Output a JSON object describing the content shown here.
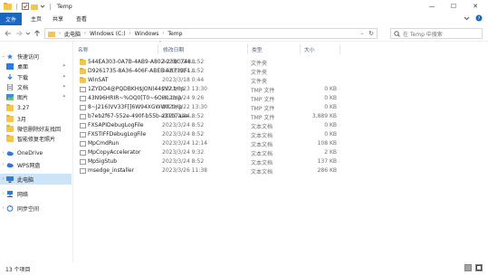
{
  "window": {
    "title": "Temp",
    "controls": {
      "minimize": "—",
      "maximize": "☐",
      "close": "✕"
    }
  },
  "ribbon": {
    "tabs": [
      "文件",
      "主页",
      "共享",
      "查看"
    ]
  },
  "address": {
    "crumbs": [
      "此电脑",
      "Windows (C:)",
      "Windows",
      "Temp"
    ],
    "search_placeholder": "在 Temp 中搜索"
  },
  "sidebar": {
    "items": [
      {
        "label": "快速访问",
        "icon": "star-icon",
        "expand": "⌄"
      },
      {
        "label": "桌面",
        "icon": "desktop-icon",
        "pinned": true
      },
      {
        "label": "下载",
        "icon": "download-icon",
        "pinned": true
      },
      {
        "label": "文档",
        "icon": "document-icon",
        "pinned": true
      },
      {
        "label": "图片",
        "icon": "picture-icon",
        "pinned": true
      },
      {
        "label": "3.27",
        "icon": "folder-icon"
      },
      {
        "label": "3月",
        "icon": "folder-icon"
      },
      {
        "label": "微信删除好友找回",
        "icon": "folder-icon"
      },
      {
        "label": "智能修复老照片",
        "icon": "folder-icon"
      },
      {
        "label": "OneDrive",
        "icon": "cloud-icon",
        "expand": "›"
      },
      {
        "label": "WPS网盘",
        "icon": "wps-cloud-icon",
        "expand": "›"
      },
      {
        "label": "此电脑",
        "icon": "computer-icon",
        "expand": "›",
        "selected": true
      },
      {
        "label": "网络",
        "icon": "network-icon",
        "expand": "›"
      },
      {
        "label": "同步空间",
        "icon": "sync-icon",
        "expand": "›"
      }
    ]
  },
  "columns": {
    "name": "名称",
    "date": "修改日期",
    "type": "类型",
    "size": "大小"
  },
  "files": [
    {
      "name": "544EA303-0A7B-4AB9-A802-23BC748...",
      "date": "2023/3/24 8:52",
      "type": "文件夹",
      "size": "",
      "kind": "folder"
    },
    {
      "name": "D9261735-8A36-406F-ABEB-AB719F1...",
      "date": "2023/3/24 8:52",
      "type": "文件夹",
      "size": "",
      "kind": "folder"
    },
    {
      "name": "WinSAT",
      "date": "2023/3/18 0:44",
      "type": "文件夹",
      "size": "",
      "kind": "folder"
    },
    {
      "name": "1ZYDO4@PQDBKH$JON)44$V2.tmp",
      "date": "2023/3/23 13:30",
      "type": "TMP 文件",
      "size": "0 KB",
      "kind": "file"
    },
    {
      "name": "43N96HRIR~%OQ0[T0~6OHL.tmp",
      "date": "2023/3/24 9:26",
      "type": "TMP 文件",
      "size": "0 KB",
      "kind": "file"
    },
    {
      "name": "8~J216)VV33F[]6W94XGWWX.tmp",
      "date": "2023/3/22 13:30",
      "type": "TMP 文件",
      "size": "0 KB",
      "kind": "file"
    },
    {
      "name": "b7eb2f67-552e-490f-b55b-a31b7aae...",
      "date": "2023/3/24 8:52",
      "type": "TMP 文件",
      "size": "3,889 KB",
      "kind": "file"
    },
    {
      "name": "FXSAPIDebugLogFile",
      "date": "2023/3/24 8:52",
      "type": "文本文档",
      "size": "0 KB",
      "kind": "file"
    },
    {
      "name": "FXSTIFFDebugLogFile",
      "date": "2023/3/24 8:52",
      "type": "文本文档",
      "size": "0 KB",
      "kind": "file"
    },
    {
      "name": "MpCmdRun",
      "date": "2023/3/24 12:14",
      "type": "文本文档",
      "size": "108 KB",
      "kind": "file"
    },
    {
      "name": "MpCopyAccelerator",
      "date": "2023/3/24 9:32",
      "type": "文本文档",
      "size": "2 KB",
      "kind": "file"
    },
    {
      "name": "MpSigStub",
      "date": "2023/3/24 8:52",
      "type": "文本文档",
      "size": "137 KB",
      "kind": "file"
    },
    {
      "name": "msedge_installer",
      "date": "2023/3/26 11:38",
      "type": "文本文档",
      "size": "286 KB",
      "kind": "file"
    }
  ],
  "status": {
    "count": "13 个项目"
  }
}
